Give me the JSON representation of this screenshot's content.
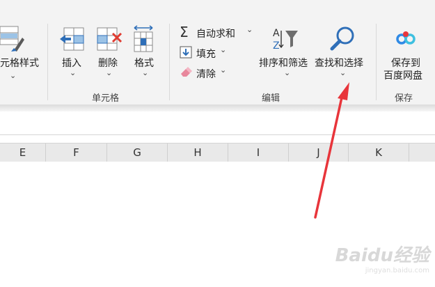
{
  "ribbon": {
    "cell_style_button": "元格样式",
    "cells_group": {
      "label": "单元格",
      "insert": "插入",
      "delete": "删除",
      "format": "格式"
    },
    "edit_group": {
      "label": "编辑",
      "autosum": "自动求和",
      "fill": "填充",
      "clear": "清除",
      "sort_filter": "排序和筛选",
      "find_select": "查找和选择"
    },
    "save_group": {
      "label": "保存",
      "save_line1": "保存到",
      "save_line2": "百度网盘"
    }
  },
  "columns": [
    "E",
    "F",
    "G",
    "H",
    "I",
    "J",
    "K"
  ],
  "watermark": {
    "logo": "Baidu经验",
    "url": "jingyan.baidu.com"
  },
  "colors": {
    "ribbon_bg": "#f3f3f3",
    "header_bg": "#e9e9e9",
    "accent_blue": "#2f6fb8",
    "annotation_red": "#e8353b"
  }
}
